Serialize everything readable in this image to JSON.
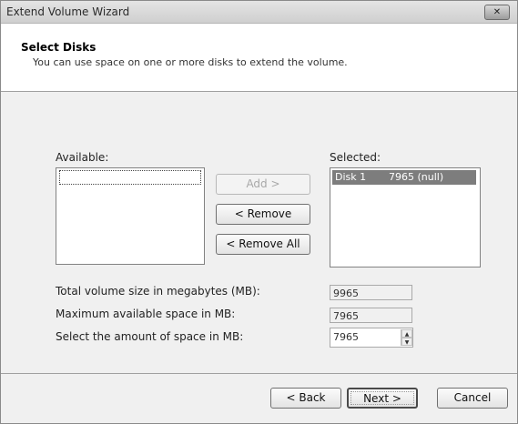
{
  "window": {
    "title": "Extend Volume Wizard",
    "close_glyph": "✕"
  },
  "header": {
    "title": "Select Disks",
    "subtitle": "You can use space on one or more disks to extend the volume."
  },
  "available": {
    "label": "Available:"
  },
  "buttons": {
    "add": "Add >",
    "remove": "< Remove",
    "remove_all": "< Remove All"
  },
  "selected": {
    "label": "Selected:",
    "items": [
      {
        "disk": "Disk 1",
        "size": "7965 (null)"
      }
    ]
  },
  "fields": {
    "total_label": "Total volume size in megabytes (MB):",
    "total_value": "9965",
    "max_label": "Maximum available space in MB:",
    "max_value": "7965",
    "amount_label": "Select the amount of space in MB:",
    "amount_value": "7965"
  },
  "footer": {
    "back": "< Back",
    "next": "Next >",
    "cancel": "Cancel"
  },
  "icons": {
    "close": "close-icon",
    "spin_up": "chevron-up-icon",
    "spin_down": "chevron-down-icon"
  }
}
